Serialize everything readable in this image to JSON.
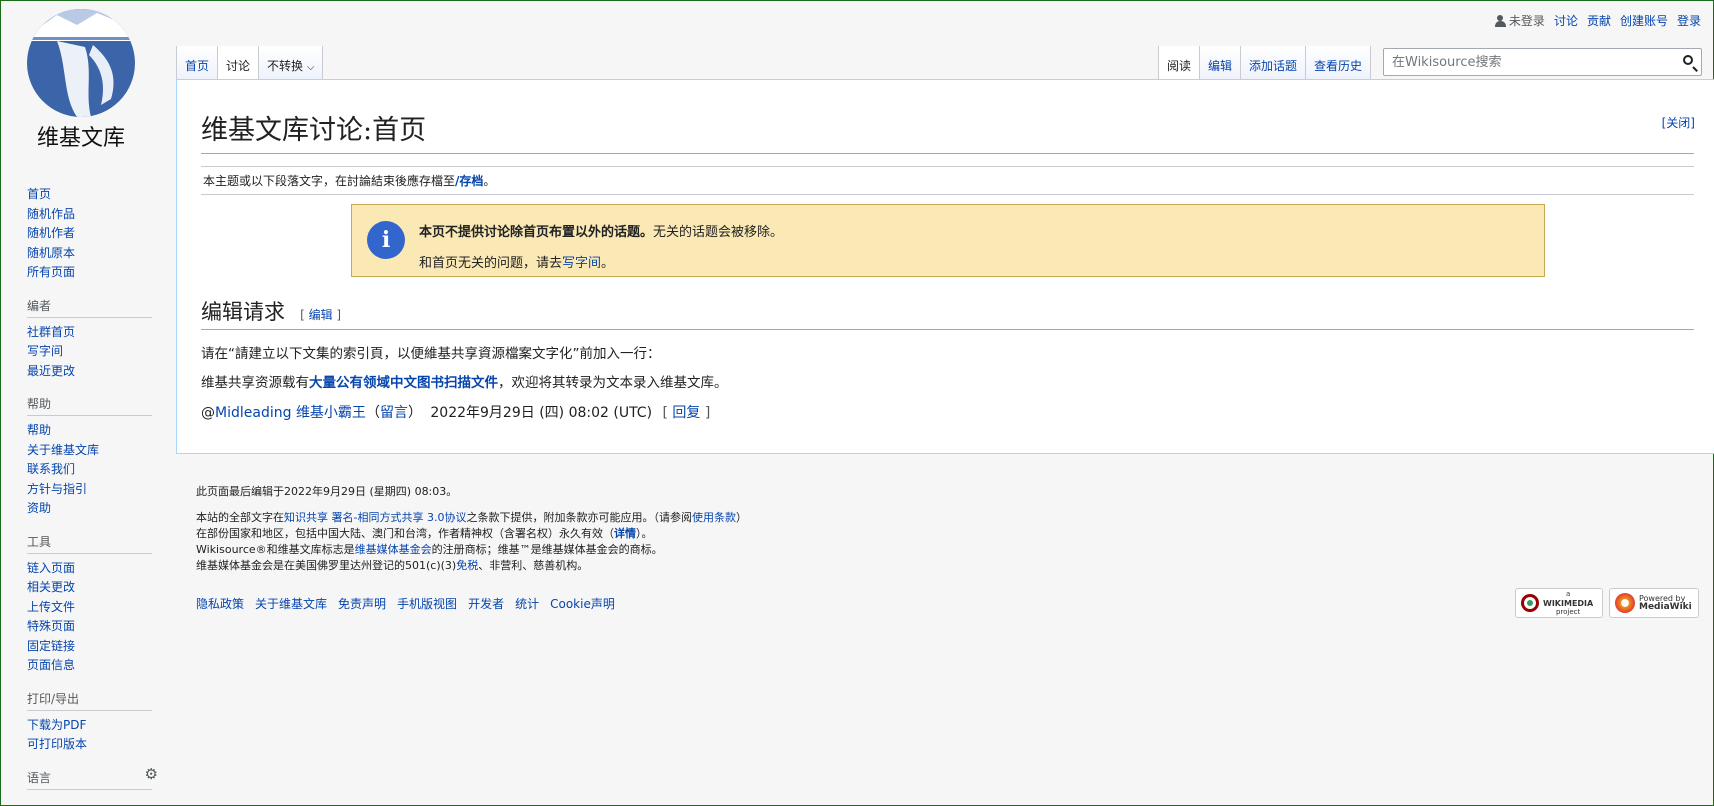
{
  "logo": {
    "wordmark": "维基文库"
  },
  "personal": {
    "not_logged_in": "未登录",
    "talk": "讨论",
    "contributions": "贡献",
    "create_account": "创建账号",
    "login": "登录"
  },
  "tabs": {
    "left": [
      "首页",
      "讨论"
    ],
    "variant": "不转换",
    "right": [
      "阅读",
      "编辑",
      "添加话题",
      "查看历史"
    ]
  },
  "search": {
    "placeholder": "在Wikisource搜索"
  },
  "sidebar": {
    "nav": [
      "首页",
      "随机作品",
      "随机作者",
      "随机原本",
      "所有页面"
    ],
    "editors": {
      "heading": "编者",
      "items": [
        "社群首页",
        "写字间",
        "最近更改"
      ]
    },
    "help": {
      "heading": "帮助",
      "items": [
        "帮助",
        "关于维基文库",
        "联系我们",
        "方针与指引",
        "资助"
      ]
    },
    "tools": {
      "heading": "工具",
      "items": [
        "链入页面",
        "相关更改",
        "上传文件",
        "特殊页面",
        "固定链接",
        "页面信息"
      ]
    },
    "print": {
      "heading": "打印/导出",
      "items": [
        "下载为PDF",
        "可打印版本"
      ]
    },
    "languages": {
      "heading": "语言"
    }
  },
  "content": {
    "title": "维基文库讨论:首页",
    "close": "[关闭]",
    "archive_text": "本主题或以下段落文字，在討論結束後應存檔至",
    "archive_link": "/存档",
    "archive_end": "。",
    "notice_bold": "本页不提供讨论除首页布置以外的话题。",
    "notice_rest": "无关的话题会被移除。",
    "notice_line2_a": "和首页无关的问题，请去",
    "notice_line2_link": "写字间",
    "notice_line2_b": "。",
    "section_title": "编辑请求",
    "section_edit_open": "[ ",
    "section_edit_link": "编辑",
    "section_edit_close": " ]",
    "para1": "请在“請建立以下文集的索引頁，以便維基共享資源檔案文字化”前加入一行：",
    "para2_a": "维基共享资源载有",
    "para2_link": "大量公有领域中文图书扫描文件",
    "para2_b": "，欢迎将其转录为文本录入维基文库。",
    "sig_at": "@",
    "sig_user_ping": "Midleading",
    "sig_user": "维基小霸王",
    "sig_paren_open": "（",
    "sig_talk": "留言",
    "sig_paren_close": "）",
    "sig_time": "2022年9月29日 (四) 08:02 (UTC)",
    "reply_open": "[ ",
    "reply": "回复",
    "reply_close": " ]"
  },
  "footer": {
    "last_modified": "此页面最后编辑于2022年9月29日 (星期四) 08:03。",
    "lic1_a": "本站的全部文字在",
    "lic1_link": "知识共享 署名-相同方式共享 3.0协议",
    "lic1_b": "之条款下提供，附加条款亦可能应用。（请参阅",
    "lic1_link2": "使用条款",
    "lic1_c": "）",
    "lic2_a": "在部份国家和地区，包括中国大陆、澳门和台湾，作者精神权（含署名权）永久有效（",
    "lic2_link": "详情",
    "lic2_b": "）。",
    "lic3_a": "Wikisource®和维基文库标志是",
    "lic3_link": "维基媒体基金会",
    "lic3_b": "的注册商标；维基™是维基媒体基金会的商标。",
    "lic4_a": "维基媒体基金会是在美国佛罗里达州登记的501(c)(3)",
    "lic4_link": "免税",
    "lic4_b": "、非营利、慈善机构。",
    "places": [
      "隐私政策",
      "关于维基文库",
      "免责声明",
      "手机版视图",
      "开发者",
      "统计",
      "Cookie声明"
    ],
    "wikimedia_badge": [
      "a",
      "WIKIMEDIA",
      "project"
    ],
    "mediawiki_badge": [
      "Powered by",
      "MediaWiki"
    ]
  }
}
